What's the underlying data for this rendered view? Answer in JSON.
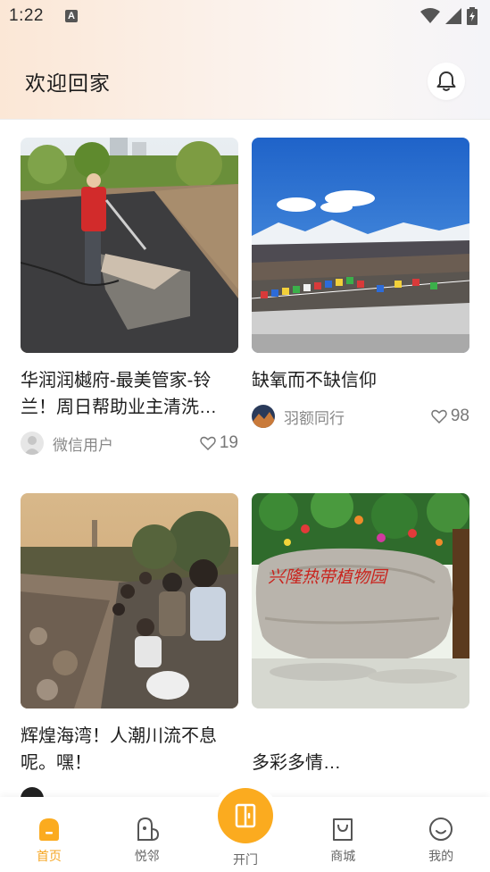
{
  "status_bar": {
    "time": "1:22",
    "notification_glyph": "A"
  },
  "header": {
    "title": "欢迎回家",
    "bell_icon": "bell-icon"
  },
  "feed": [
    {
      "title": "华润润樾府-最美管家-铃兰！周日帮助业主清洗…",
      "author": "微信用户",
      "likes": "19",
      "image": "worker washing a mat on a wet street"
    },
    {
      "title": "缺氧而不缺信仰",
      "author": "羽额同行",
      "likes": "98",
      "image": "snow mountains with prayer flags"
    },
    {
      "title": "辉煌海湾！人潮川流不息呢。嘿！",
      "author": "",
      "likes": "",
      "image": "crowd on rocky shore at sunset"
    },
    {
      "title": "多彩多情…",
      "author": "",
      "likes": "",
      "image": "botanical garden stone sign"
    }
  ],
  "sign_text": "兴隆热带植物园",
  "tabs": [
    {
      "label": "首页",
      "icon": "home-icon",
      "active": true
    },
    {
      "label": "悦邻",
      "icon": "neighbor-icon",
      "active": false
    },
    {
      "label": "开门",
      "icon": "door-icon",
      "active": false
    },
    {
      "label": "商城",
      "icon": "shopping-bag-icon",
      "active": false
    },
    {
      "label": "我的",
      "icon": "smile-icon",
      "active": false
    }
  ],
  "colors": {
    "accent": "#fbab1f",
    "active_tab": "#f6a623"
  }
}
